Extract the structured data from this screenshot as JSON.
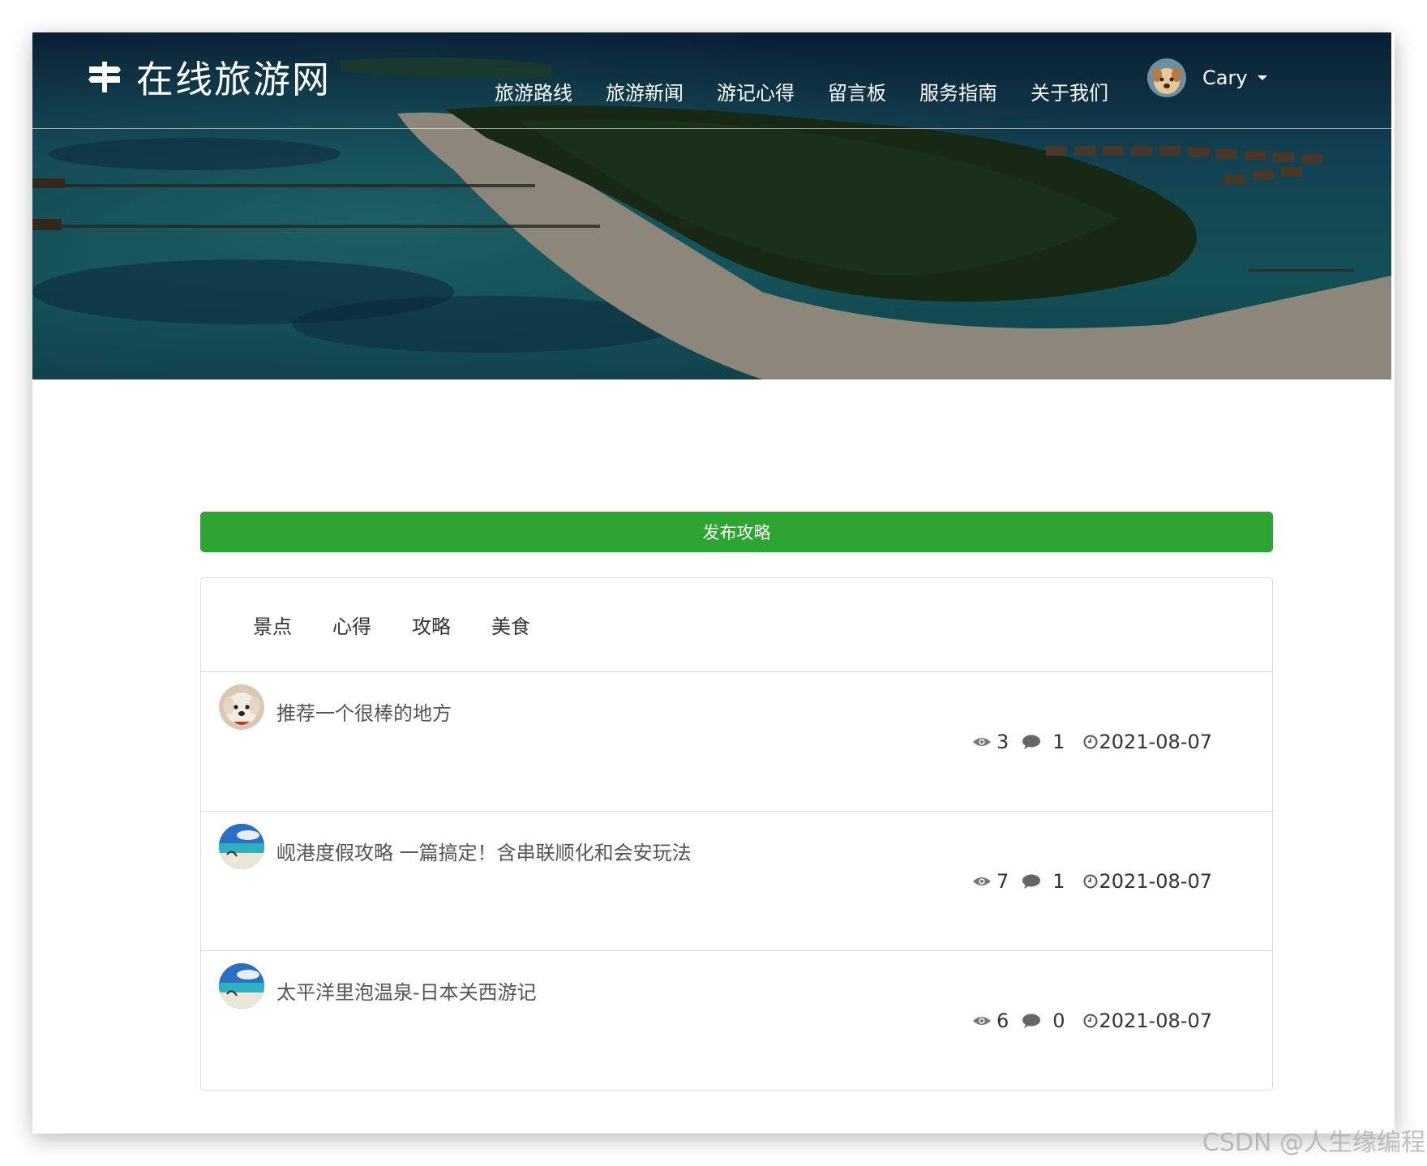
{
  "brand": {
    "title": "在线旅游网",
    "logo_icon": "signpost-icon"
  },
  "nav": {
    "items": [
      "旅游路线",
      "旅游新闻",
      "游记心得",
      "留言板",
      "服务指南",
      "关于我们"
    ]
  },
  "user": {
    "name": "Cary",
    "avatar_icon": "dog-avatar"
  },
  "publish_button": {
    "label": "发布攻略",
    "color": "#2ea432"
  },
  "tabs": [
    "景点",
    "心得",
    "攻略",
    "美食"
  ],
  "posts": [
    {
      "title": "推荐一个很棒的地方",
      "views": "3",
      "comments": "1",
      "date": "2021-08-07",
      "avatar": "dog-avatar"
    },
    {
      "title": "岘港度假攻略 一篇搞定！含串联顺化和会安玩法",
      "views": "7",
      "comments": "1",
      "date": "2021-08-07",
      "avatar": "beach-avatar"
    },
    {
      "title": "太平洋里泡温泉-日本关西游记",
      "views": "6",
      "comments": "0",
      "date": "2021-08-07",
      "avatar": "beach-avatar"
    }
  ],
  "icons": {
    "views": "eye-icon",
    "comments": "comment-bubble-icon",
    "date": "clock-icon"
  },
  "watermark": "CSDN @人生缘编程"
}
